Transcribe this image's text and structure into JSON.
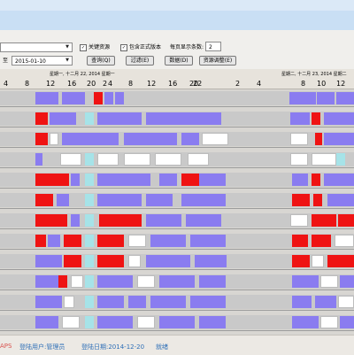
{
  "toolbar": {
    "combo1_value": "",
    "to_label": "至",
    "date_to_value": "2015-01-10",
    "check_key_resource": "关键资源",
    "check_include_official": "包含正式版本",
    "per_page_label": "每页显示条数:",
    "per_page_value": "2",
    "query_btn": "查询(Q)",
    "filter_btn": "过滤(E)",
    "data_btn": "数据(D)",
    "resource_adjust_btn": "资源调整(E)"
  },
  "ruler": {
    "day1": "星期一, 十二月 22, 2014  星期一",
    "day2": "星期二, 十二月 23, 2014  星期二",
    "hours1": [
      "4",
      "8",
      "12",
      "16",
      "20"
    ],
    "hours_mid": [
      "2",
      "4",
      "8",
      "12",
      "16",
      "20",
      "22"
    ],
    "hours2": [
      "2",
      "4",
      "8",
      "10",
      "12"
    ]
  },
  "status": {
    "app": "APS",
    "user": "登陆用户:管理员",
    "date": "登陆日期:2014-12-20",
    "state": "就绪"
  },
  "colors": {
    "purple": "#8a7cf0",
    "red": "#ef1313",
    "cyan": "#a6e3e8",
    "white": "#ffffff"
  }
}
